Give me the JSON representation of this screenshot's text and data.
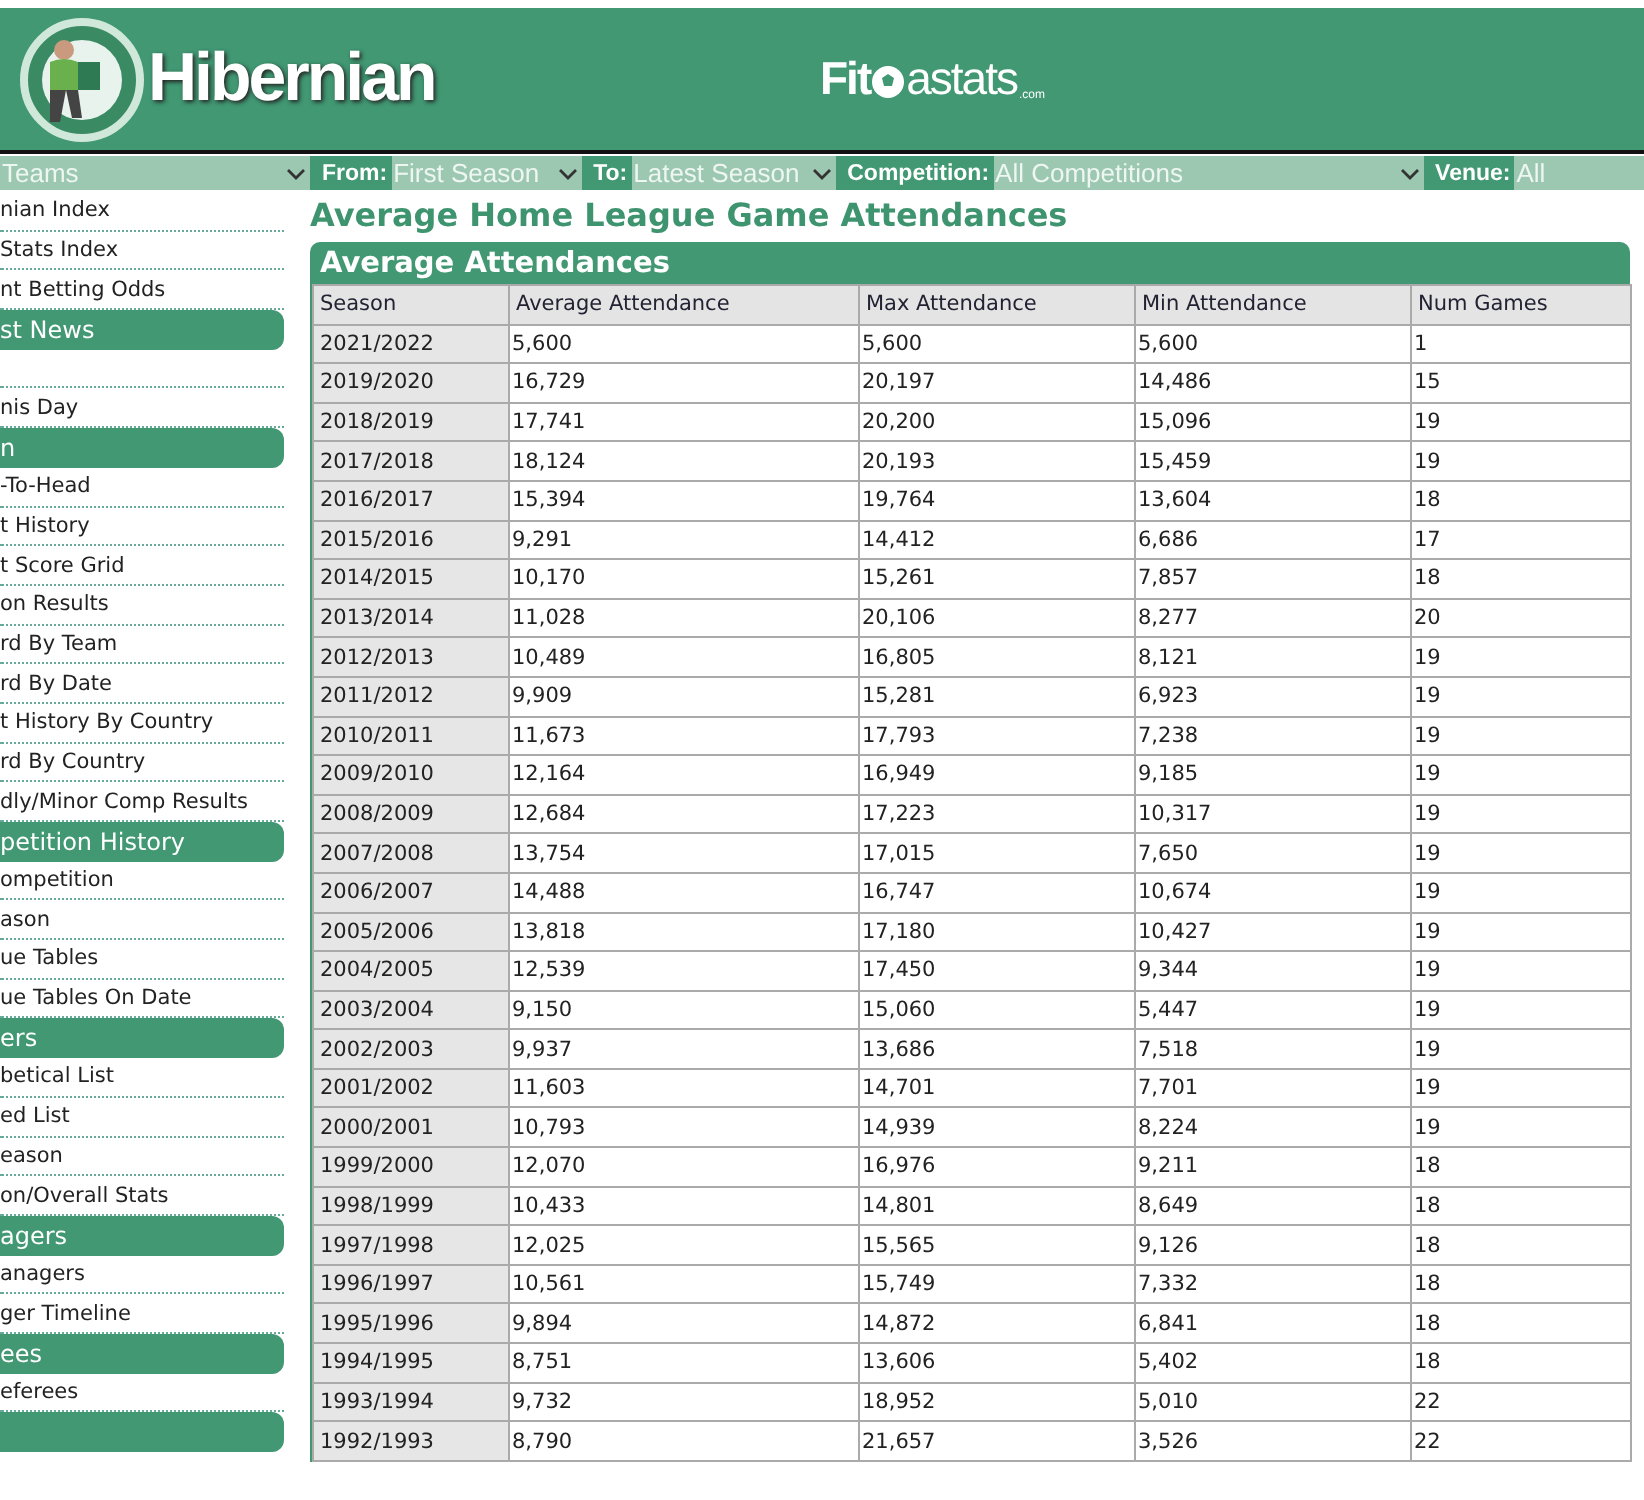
{
  "header": {
    "team_name": "Hibernian",
    "site_logo": {
      "lead": "Fit",
      "tail": "astats",
      "suffix": ".com"
    }
  },
  "filters": [
    {
      "kind": "select",
      "value": "Teams"
    },
    {
      "kind": "label",
      "text": "From:"
    },
    {
      "kind": "select",
      "value": "First Season"
    },
    {
      "kind": "label",
      "text": "To:"
    },
    {
      "kind": "select",
      "value": "Latest Season"
    },
    {
      "kind": "label",
      "text": "Competition:"
    },
    {
      "kind": "select",
      "value": "All Competitions"
    },
    {
      "kind": "label",
      "text": "Venue:"
    },
    {
      "kind": "select",
      "value": "All"
    }
  ],
  "sidebar": [
    {
      "kind": "link",
      "label": "nian Index"
    },
    {
      "kind": "link",
      "label": "Stats Index"
    },
    {
      "kind": "link",
      "label": "nt Betting Odds"
    },
    {
      "kind": "header",
      "label": "st News"
    },
    {
      "kind": "blank"
    },
    {
      "kind": "link",
      "label": "nis Day"
    },
    {
      "kind": "header",
      "label": "n"
    },
    {
      "kind": "link",
      "label": "-To-Head"
    },
    {
      "kind": "link",
      "label": "t History"
    },
    {
      "kind": "link",
      "label": "t Score Grid"
    },
    {
      "kind": "link",
      "label": "on Results"
    },
    {
      "kind": "link",
      "label": "rd By Team"
    },
    {
      "kind": "link",
      "label": "rd By Date"
    },
    {
      "kind": "link",
      "label": "t History By Country"
    },
    {
      "kind": "link",
      "label": "rd By Country"
    },
    {
      "kind": "link",
      "label": "dly/Minor Comp Results"
    },
    {
      "kind": "header",
      "label": "petition History"
    },
    {
      "kind": "link",
      "label": "ompetition"
    },
    {
      "kind": "link",
      "label": "ason"
    },
    {
      "kind": "link",
      "label": "ue Tables"
    },
    {
      "kind": "link",
      "label": "ue Tables On Date"
    },
    {
      "kind": "header",
      "label": "ers"
    },
    {
      "kind": "link",
      "label": "betical List"
    },
    {
      "kind": "link",
      "label": "ed List"
    },
    {
      "kind": "link",
      "label": "eason"
    },
    {
      "kind": "link",
      "label": "on/Overall Stats"
    },
    {
      "kind": "header",
      "label": "agers"
    },
    {
      "kind": "link",
      "label": "anagers"
    },
    {
      "kind": "link",
      "label": "ger Timeline"
    },
    {
      "kind": "header",
      "label": "ees"
    },
    {
      "kind": "link",
      "label": "eferees"
    },
    {
      "kind": "header"
    }
  ],
  "page_title": "Average Home League Game Attendances",
  "table": {
    "title": "Average Attendances",
    "columns": [
      "Season",
      "Average Attendance",
      "Max Attendance",
      "Min Attendance",
      "Num Games"
    ],
    "rows": [
      [
        "2021/2022",
        "5,600",
        "5,600",
        "5,600",
        "1"
      ],
      [
        "2019/2020",
        "16,729",
        "20,197",
        "14,486",
        "15"
      ],
      [
        "2018/2019",
        "17,741",
        "20,200",
        "15,096",
        "19"
      ],
      [
        "2017/2018",
        "18,124",
        "20,193",
        "15,459",
        "19"
      ],
      [
        "2016/2017",
        "15,394",
        "19,764",
        "13,604",
        "18"
      ],
      [
        "2015/2016",
        "9,291",
        "14,412",
        "6,686",
        "17"
      ],
      [
        "2014/2015",
        "10,170",
        "15,261",
        "7,857",
        "18"
      ],
      [
        "2013/2014",
        "11,028",
        "20,106",
        "8,277",
        "20"
      ],
      [
        "2012/2013",
        "10,489",
        "16,805",
        "8,121",
        "19"
      ],
      [
        "2011/2012",
        "9,909",
        "15,281",
        "6,923",
        "19"
      ],
      [
        "2010/2011",
        "11,673",
        "17,793",
        "7,238",
        "19"
      ],
      [
        "2009/2010",
        "12,164",
        "16,949",
        "9,185",
        "19"
      ],
      [
        "2008/2009",
        "12,684",
        "17,223",
        "10,317",
        "19"
      ],
      [
        "2007/2008",
        "13,754",
        "17,015",
        "7,650",
        "19"
      ],
      [
        "2006/2007",
        "14,488",
        "16,747",
        "10,674",
        "19"
      ],
      [
        "2005/2006",
        "13,818",
        "17,180",
        "10,427",
        "19"
      ],
      [
        "2004/2005",
        "12,539",
        "17,450",
        "9,344",
        "19"
      ],
      [
        "2003/2004",
        "9,150",
        "15,060",
        "5,447",
        "19"
      ],
      [
        "2002/2003",
        "9,937",
        "13,686",
        "7,518",
        "19"
      ],
      [
        "2001/2002",
        "11,603",
        "14,701",
        "7,701",
        "19"
      ],
      [
        "2000/2001",
        "10,793",
        "14,939",
        "8,224",
        "19"
      ],
      [
        "1999/2000",
        "12,070",
        "16,976",
        "9,211",
        "18"
      ],
      [
        "1998/1999",
        "10,433",
        "14,801",
        "8,649",
        "18"
      ],
      [
        "1997/1998",
        "12,025",
        "15,565",
        "9,126",
        "18"
      ],
      [
        "1996/1997",
        "10,561",
        "15,749",
        "7,332",
        "18"
      ],
      [
        "1995/1996",
        "9,894",
        "14,872",
        "6,841",
        "18"
      ],
      [
        "1994/1995",
        "8,751",
        "13,606",
        "5,402",
        "18"
      ],
      [
        "1993/1994",
        "9,732",
        "18,952",
        "5,010",
        "22"
      ],
      [
        "1992/1993",
        "8,790",
        "21,657",
        "3,526",
        "22"
      ]
    ]
  }
}
